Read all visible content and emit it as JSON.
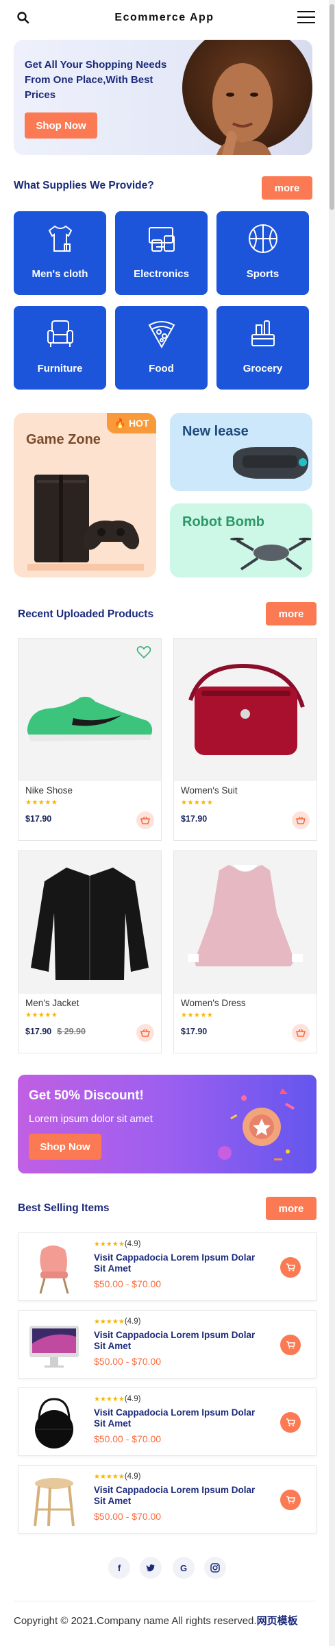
{
  "header": {
    "title": "Ecommerce App",
    "search_icon": "search-icon",
    "menu_icon": "hamburger-menu-icon"
  },
  "hero": {
    "text": "Get All Your Shopping Needs From One Place,With Best Prices",
    "button": "Shop Now"
  },
  "supplies": {
    "title": "What Supplies We Provide?",
    "more": "more",
    "categories": [
      {
        "label": "Men's cloth",
        "icon": "tshirt-icon"
      },
      {
        "label": "Electronics",
        "icon": "devices-icon"
      },
      {
        "label": "Sports",
        "icon": "basketball-icon"
      },
      {
        "label": "Furniture",
        "icon": "armchair-icon"
      },
      {
        "label": "Food",
        "icon": "pizza-icon"
      },
      {
        "label": "Grocery",
        "icon": "grocery-icon"
      }
    ]
  },
  "promos": {
    "game": {
      "title": "Game Zone",
      "badge": "HOT"
    },
    "lease": {
      "title": "New lease"
    },
    "robot": {
      "title": "Robot Bomb"
    }
  },
  "recent": {
    "title": "Recent Uploaded Products",
    "more": "more",
    "products": [
      {
        "name": "Nike Shose",
        "price": "$17.90",
        "old_price": "",
        "rating": 5
      },
      {
        "name": "Women's Suit",
        "price": "$17.90",
        "old_price": "",
        "rating": 5
      },
      {
        "name": "Men's Jacket",
        "price": "$17.90",
        "old_price": "$ 29.90",
        "rating": 5
      },
      {
        "name": "Women's Dress",
        "price": "$17.90",
        "old_price": "",
        "rating": 5
      }
    ]
  },
  "discount": {
    "title": "Get 50% Discount!",
    "text": "Lorem ipsum dolor sit amet",
    "button": "Shop Now"
  },
  "best": {
    "title": "Best Selling Items",
    "more": "more",
    "items": [
      {
        "rating": "(4.9)",
        "title": "Visit Cappadocia Lorem Ipsum Dolar Sit Amet",
        "price": "$50.00 - $70.00"
      },
      {
        "rating": "(4.9)",
        "title": "Visit Cappadocia Lorem Ipsum Dolar Sit Amet",
        "price": "$50.00 - $70.00"
      },
      {
        "rating": "(4.9)",
        "title": "Visit Cappadocia Lorem Ipsum Dolar Sit Amet",
        "price": "$50.00 - $70.00"
      },
      {
        "rating": "(4.9)",
        "title": "Visit Cappadocia Lorem Ipsum Dolar Sit Amet",
        "price": "$50.00 - $70.00"
      }
    ]
  },
  "social": {
    "facebook": "f",
    "twitter": "t",
    "google": "G",
    "instagram": "instagram-icon"
  },
  "footer": {
    "copyright": "Copyright © 2021.Company name All rights reserved.",
    "link": "网页模板"
  },
  "colors": {
    "primary": "#1c55d9",
    "accent": "#fb7a53",
    "heading": "#1b2a7a"
  }
}
